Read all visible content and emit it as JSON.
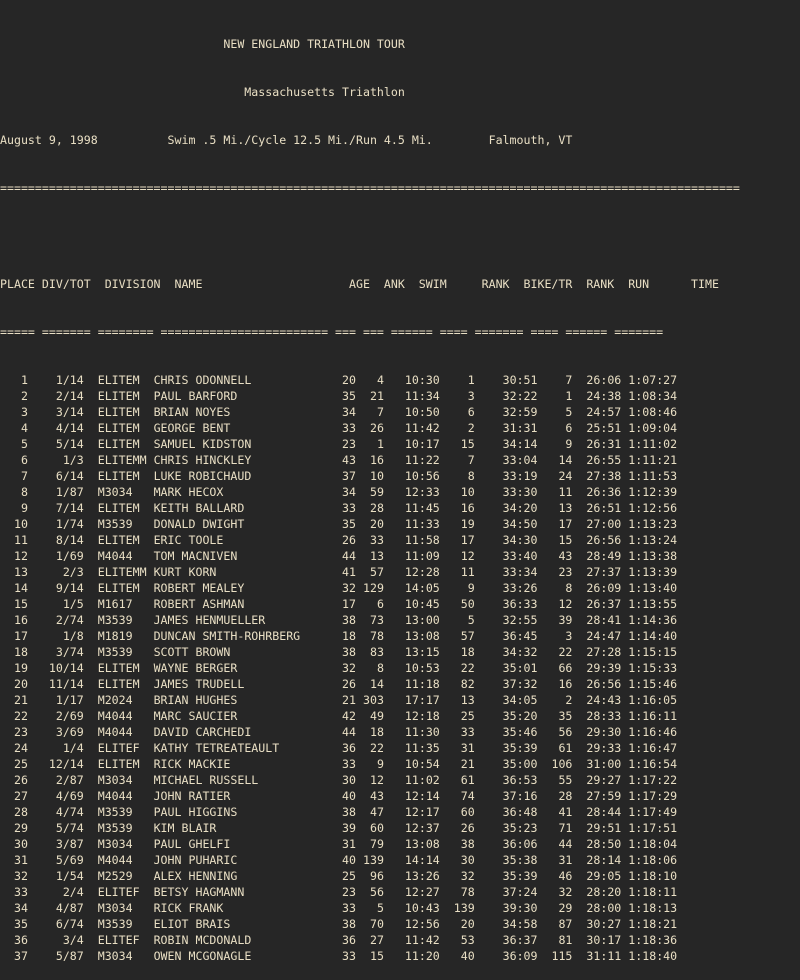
{
  "header": {
    "title_line": "                                NEW ENGLAND TRIATHLON TOUR",
    "subtitle_line": "                                   Massachusetts Triathlon",
    "info_line": "August 9, 1998          Swim .5 Mi./Cycle 12.5 Mi./Run 4.5 Mi.        Falmouth, VT",
    "rule_line": "=========================================================================================================="
  },
  "columns": {
    "header_line": "PLACE DIV/TOT  DIVISION  NAME                     AGE  ANK  SWIM     RANK  BIKE/TR  RANK  RUN      TIME",
    "underline_line": "===== ======= ======== ======================== === === ====== ==== ======= ==== ====== ======="
  },
  "rows": [
    [
      "1",
      "1/14",
      "ELITEM",
      "CHRIS ODONNELL",
      "20",
      "4",
      "10:30",
      "1",
      "30:51",
      "7",
      "26:06",
      "1:07:27"
    ],
    [
      "2",
      "2/14",
      "ELITEM",
      "PAUL BARFORD",
      "35",
      "21",
      "11:34",
      "3",
      "32:22",
      "1",
      "24:38",
      "1:08:34"
    ],
    [
      "3",
      "3/14",
      "ELITEM",
      "BRIAN NOYES",
      "34",
      "7",
      "10:50",
      "6",
      "32:59",
      "5",
      "24:57",
      "1:08:46"
    ],
    [
      "4",
      "4/14",
      "ELITEM",
      "GEORGE BENT",
      "33",
      "26",
      "11:42",
      "2",
      "31:31",
      "6",
      "25:51",
      "1:09:04"
    ],
    [
      "5",
      "5/14",
      "ELITEM",
      "SAMUEL KIDSTON",
      "23",
      "1",
      "10:17",
      "15",
      "34:14",
      "9",
      "26:31",
      "1:11:02"
    ],
    [
      "6",
      "1/3",
      "ELITEMM",
      "CHRIS HINCKLEY",
      "43",
      "16",
      "11:22",
      "7",
      "33:04",
      "14",
      "26:55",
      "1:11:21"
    ],
    [
      "7",
      "6/14",
      "ELITEM",
      "LUKE ROBICHAUD",
      "37",
      "10",
      "10:56",
      "8",
      "33:19",
      "24",
      "27:38",
      "1:11:53"
    ],
    [
      "8",
      "1/87",
      "M3034",
      "MARK HECOX",
      "34",
      "59",
      "12:33",
      "10",
      "33:30",
      "11",
      "26:36",
      "1:12:39"
    ],
    [
      "9",
      "7/14",
      "ELITEM",
      "KEITH BALLARD",
      "33",
      "28",
      "11:45",
      "16",
      "34:20",
      "13",
      "26:51",
      "1:12:56"
    ],
    [
      "10",
      "1/74",
      "M3539",
      "DONALD DWIGHT",
      "35",
      "20",
      "11:33",
      "19",
      "34:50",
      "17",
      "27:00",
      "1:13:23"
    ],
    [
      "11",
      "8/14",
      "ELITEM",
      "ERIC TOOLE",
      "26",
      "33",
      "11:58",
      "17",
      "34:30",
      "15",
      "26:56",
      "1:13:24"
    ],
    [
      "12",
      "1/69",
      "M4044",
      "TOM MACNIVEN",
      "44",
      "13",
      "11:09",
      "12",
      "33:40",
      "43",
      "28:49",
      "1:13:38"
    ],
    [
      "13",
      "2/3",
      "ELITEMM",
      "KURT KORN",
      "41",
      "57",
      "12:28",
      "11",
      "33:34",
      "23",
      "27:37",
      "1:13:39"
    ],
    [
      "14",
      "9/14",
      "ELITEM",
      "ROBERT MEALEY",
      "32",
      "129",
      "14:05",
      "9",
      "33:26",
      "8",
      "26:09",
      "1:13:40"
    ],
    [
      "15",
      "1/5",
      "M1617",
      "ROBERT ASHMAN",
      "17",
      "6",
      "10:45",
      "50",
      "36:33",
      "12",
      "26:37",
      "1:13:55"
    ],
    [
      "16",
      "2/74",
      "M3539",
      "JAMES HENMUELLER",
      "38",
      "73",
      "13:00",
      "5",
      "32:55",
      "39",
      "28:41",
      "1:14:36"
    ],
    [
      "17",
      "1/8",
      "M1819",
      "DUNCAN SMITH-ROHRBERG",
      "18",
      "78",
      "13:08",
      "57",
      "36:45",
      "3",
      "24:47",
      "1:14:40"
    ],
    [
      "18",
      "3/74",
      "M3539",
      "SCOTT BROWN",
      "38",
      "83",
      "13:15",
      "18",
      "34:32",
      "22",
      "27:28",
      "1:15:15"
    ],
    [
      "19",
      "10/14",
      "ELITEM",
      "WAYNE BERGER",
      "32",
      "8",
      "10:53",
      "22",
      "35:01",
      "66",
      "29:39",
      "1:15:33"
    ],
    [
      "20",
      "11/14",
      "ELITEM",
      "JAMES TRUDELL",
      "26",
      "14",
      "11:18",
      "82",
      "37:32",
      "16",
      "26:56",
      "1:15:46"
    ],
    [
      "21",
      "1/17",
      "M2024",
      "BRIAN HUGHES",
      "21",
      "303",
      "17:17",
      "13",
      "34:05",
      "2",
      "24:43",
      "1:16:05"
    ],
    [
      "22",
      "2/69",
      "M4044",
      "MARC SAUCIER",
      "42",
      "49",
      "12:18",
      "25",
      "35:20",
      "35",
      "28:33",
      "1:16:11"
    ],
    [
      "23",
      "3/69",
      "M4044",
      "DAVID CARCHEDI",
      "44",
      "18",
      "11:30",
      "33",
      "35:46",
      "56",
      "29:30",
      "1:16:46"
    ],
    [
      "24",
      "1/4",
      "ELITEF",
      "KATHY TETREATEAULT",
      "36",
      "22",
      "11:35",
      "31",
      "35:39",
      "61",
      "29:33",
      "1:16:47"
    ],
    [
      "25",
      "12/14",
      "ELITEM",
      "RICK MACKIE",
      "33",
      "9",
      "10:54",
      "21",
      "35:00",
      "106",
      "31:00",
      "1:16:54"
    ],
    [
      "26",
      "2/87",
      "M3034",
      "MICHAEL RUSSELL",
      "30",
      "12",
      "11:02",
      "61",
      "36:53",
      "55",
      "29:27",
      "1:17:22"
    ],
    [
      "27",
      "4/69",
      "M4044",
      "JOHN RATIER",
      "40",
      "43",
      "12:14",
      "74",
      "37:16",
      "28",
      "27:59",
      "1:17:29"
    ],
    [
      "28",
      "4/74",
      "M3539",
      "PAUL HIGGINS",
      "38",
      "47",
      "12:17",
      "60",
      "36:48",
      "41",
      "28:44",
      "1:17:49"
    ],
    [
      "29",
      "5/74",
      "M3539",
      "KIM BLAIR",
      "39",
      "60",
      "12:37",
      "26",
      "35:23",
      "71",
      "29:51",
      "1:17:51"
    ],
    [
      "30",
      "3/87",
      "M3034",
      "PAUL GHELFI",
      "31",
      "79",
      "13:08",
      "38",
      "36:06",
      "44",
      "28:50",
      "1:18:04"
    ],
    [
      "31",
      "5/69",
      "M4044",
      "JOHN PUHARIC",
      "40",
      "139",
      "14:14",
      "30",
      "35:38",
      "31",
      "28:14",
      "1:18:06"
    ],
    [
      "32",
      "1/54",
      "M2529",
      "ALEX HENNING",
      "25",
      "96",
      "13:26",
      "32",
      "35:39",
      "46",
      "29:05",
      "1:18:10"
    ],
    [
      "33",
      "2/4",
      "ELITEF",
      "BETSY HAGMANN",
      "23",
      "56",
      "12:27",
      "78",
      "37:24",
      "32",
      "28:20",
      "1:18:11"
    ],
    [
      "34",
      "4/87",
      "M3034",
      "RICK FRANK",
      "33",
      "5",
      "10:43",
      "139",
      "39:30",
      "29",
      "28:00",
      "1:18:13"
    ],
    [
      "35",
      "6/74",
      "M3539",
      "ELIOT BRAIS",
      "38",
      "70",
      "12:56",
      "20",
      "34:58",
      "87",
      "30:27",
      "1:18:21"
    ],
    [
      "36",
      "3/4",
      "ELITEF",
      "ROBIN MCDONALD",
      "36",
      "27",
      "11:42",
      "53",
      "36:37",
      "81",
      "30:17",
      "1:18:36"
    ],
    [
      "37",
      "5/87",
      "M3034",
      "OWEN MCGONAGLE",
      "33",
      "15",
      "11:20",
      "40",
      "36:09",
      "115",
      "31:11",
      "1:18:40"
    ]
  ]
}
